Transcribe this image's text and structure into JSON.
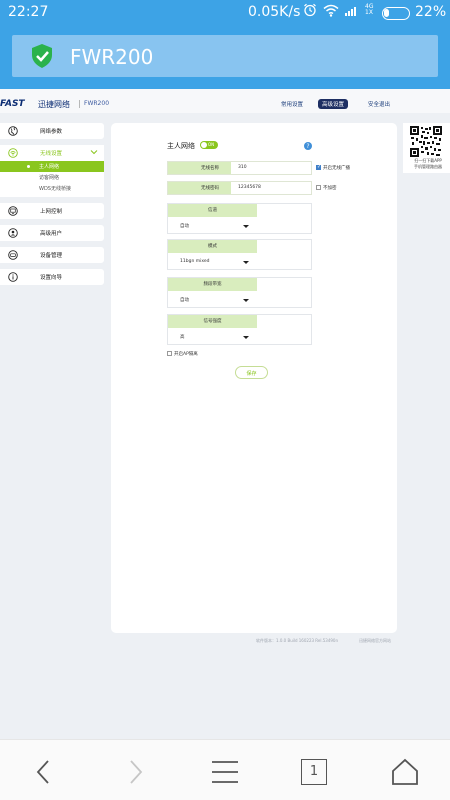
{
  "statusbar": {
    "time": "22:27",
    "speed": "0.05K/s",
    "network": "4G",
    "network_sub": "1X",
    "battery": "22%",
    "icons": [
      "alarm-icon",
      "wifi-icon",
      "signal-icon",
      "battery-icon"
    ]
  },
  "app": {
    "title": "FWR200",
    "icon": "shield-check-icon"
  },
  "web": {
    "logo": "FAST",
    "logo_cn": "迅捷网络",
    "separator": "|",
    "model": "FWR200",
    "nav": {
      "common": "常用设置",
      "advanced": "高级设置",
      "logout": "安全退出"
    },
    "sidebar": [
      {
        "label": "网络参数",
        "icon": "globe-icon"
      },
      {
        "label": "无线设置",
        "icon": "wifi-icon",
        "active": true,
        "children": [
          "主人网络",
          "访客网络",
          "WDS无线桥接"
        ]
      },
      {
        "label": "上网控制",
        "icon": "monitor-icon"
      },
      {
        "label": "高级用户",
        "icon": "user-icon"
      },
      {
        "label": "设备管理",
        "icon": "device-icon"
      },
      {
        "label": "设置向导",
        "icon": "info-icon"
      }
    ],
    "panel": {
      "title": "主人网络",
      "toggle": "ON",
      "ssid_label": "无线名称",
      "ssid_value": "310",
      "broadcast_label": "开启无线广播",
      "password_label": "无线密码",
      "password_value": "12345678",
      "no_encrypt_label": "不加密",
      "channel_label": "信道",
      "channel_value": "自动",
      "mode_label": "模式",
      "mode_value": "11bgn mixed",
      "bandwidth_label": "频段带宽",
      "bandwidth_value": "自动",
      "power_label": "信号强度",
      "power_value": "高",
      "ap_isolation_label": "开启AP隔离",
      "save": "保存"
    },
    "qr": {
      "text1": "扫一扫下载APP",
      "text2": "手机管理路由器"
    },
    "footer": {
      "version": "软件版本：1.0.0 Build 160223 Rel.53490n",
      "site": "迅捷网络官方网站"
    }
  },
  "bottomnav": {
    "tab_count": "1",
    "buttons": [
      "back-icon",
      "forward-icon",
      "menu-icon",
      "tabs-icon",
      "home-icon"
    ]
  },
  "colors": {
    "status_blue": "#3da3e6",
    "accent_green": "#8ac61e",
    "label_green": "#d9edbe",
    "dark_navy": "#1e2f63"
  }
}
